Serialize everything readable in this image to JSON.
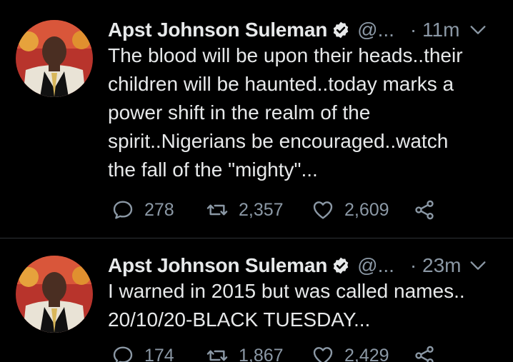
{
  "colors": {
    "background": "#000000",
    "text": "#e7e9ea",
    "secondary": "#8b98a5",
    "divider": "#2f3336"
  },
  "tweets": [
    {
      "author_name": "Apst Johnson Suleman",
      "handle": "@...",
      "time": "· 11m",
      "text": "The blood will be upon their heads..their\nchildren will be haunted..today marks a\npower shift in the realm of the\nspirit..Nigerians be encouraged..watch\nthe fall of the \"mighty\"...",
      "replies": "278",
      "retweets": "2,357",
      "likes": "2,609",
      "icons": [
        "verified-badge-icon",
        "chevron-down-icon",
        "reply-icon",
        "retweet-icon",
        "like-icon",
        "share-icon"
      ]
    },
    {
      "author_name": "Apst Johnson Suleman",
      "handle": "@...",
      "time": "· 23m",
      "text": "I warned in 2015 but was called names..\n20/10/20-BLACK TUESDAY...",
      "replies": "174",
      "retweets": "1,867",
      "likes": "2,429",
      "icons": [
        "verified-badge-icon",
        "chevron-down-icon",
        "reply-icon",
        "retweet-icon",
        "like-icon",
        "share-icon"
      ]
    }
  ]
}
